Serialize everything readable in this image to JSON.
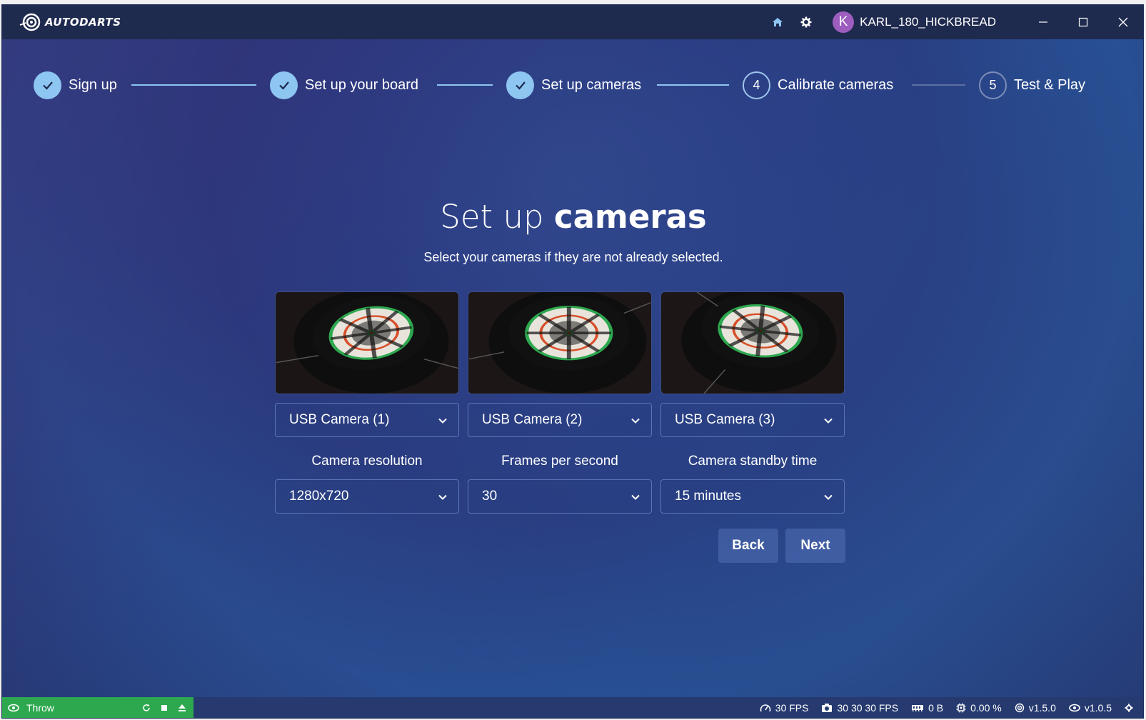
{
  "app": {
    "logo_text": "AUTODARTS"
  },
  "titlebar": {
    "user_initial": "K",
    "username": "KARL_180_HICKBREAD"
  },
  "stepper": {
    "steps": [
      {
        "label": "Sign up",
        "state": "done",
        "number": "1"
      },
      {
        "label": "Set up your board",
        "state": "done",
        "number": "2"
      },
      {
        "label": "Set up cameras",
        "state": "done",
        "number": "3"
      },
      {
        "label": "Calibrate cameras",
        "state": "current",
        "number": "4"
      },
      {
        "label": "Test & Play",
        "state": "upcoming",
        "number": "5"
      }
    ]
  },
  "main": {
    "title_light": "Set up ",
    "title_bold": "cameras",
    "subtitle": "Select your cameras if they are not already selected."
  },
  "cameras": [
    {
      "selected": "USB Camera (1)"
    },
    {
      "selected": "USB Camera (2)"
    },
    {
      "selected": "USB Camera (3)"
    }
  ],
  "settings": {
    "resolution_label": "Camera resolution",
    "resolution_value": "1280x720",
    "fps_label": "Frames per second",
    "fps_value": "30",
    "standby_label": "Camera standby time",
    "standby_value": "15 minutes"
  },
  "buttons": {
    "back": "Back",
    "next": "Next"
  },
  "statusbar": {
    "throw_label": "Throw",
    "fps": "30 FPS",
    "camera_fps": "30 30 30 FPS",
    "memory": "0 B",
    "cpu": "0.00 %",
    "board_version": "v1.5.0",
    "app_version": "v1.0.5"
  },
  "colors": {
    "titlebar": "#1f2a4f",
    "step_done": "#8ec6f2",
    "throw_green": "#2ea84f",
    "statusbar": "#263a6f"
  }
}
